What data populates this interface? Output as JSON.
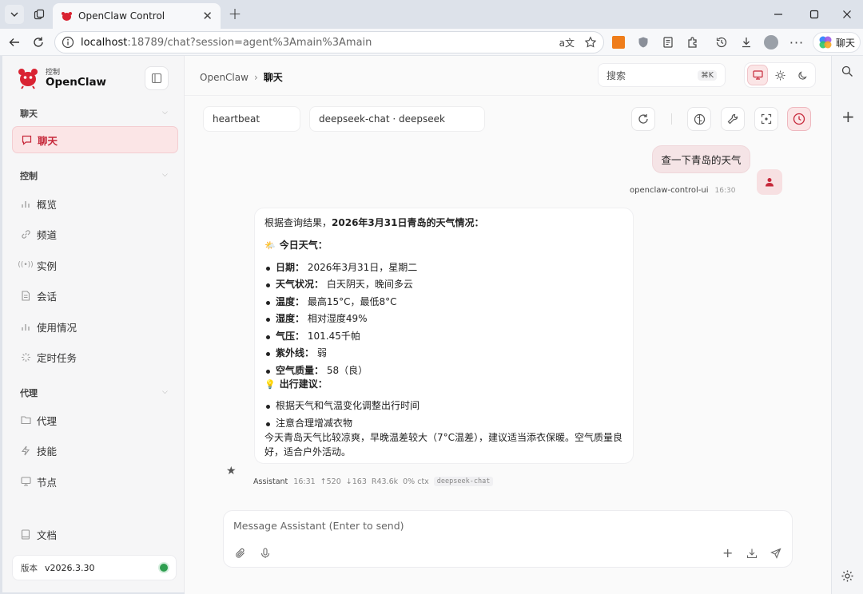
{
  "browser": {
    "tab_title": "OpenClaw Control",
    "url_host": "localhost",
    "url_rest": ":18789/chat?session=agent%3Amain%3Amain",
    "copilot_label": "聊天"
  },
  "sidebar": {
    "brand_sub": "控制",
    "brand_name": "OpenClaw",
    "sections": [
      {
        "title": "聊天",
        "items": [
          {
            "label": "聊天",
            "icon": "chat-icon",
            "active": true
          }
        ]
      },
      {
        "title": "控制",
        "items": [
          {
            "label": "概览",
            "icon": "bar-chart-icon"
          },
          {
            "label": "频道",
            "icon": "link-icon"
          },
          {
            "label": "实例",
            "icon": "radio-icon"
          },
          {
            "label": "会话",
            "icon": "document-icon"
          },
          {
            "label": "使用情况",
            "icon": "bar-chart-icon"
          },
          {
            "label": "定时任务",
            "icon": "loader-icon"
          }
        ]
      },
      {
        "title": "代理",
        "items": [
          {
            "label": "代理",
            "icon": "folder-icon"
          },
          {
            "label": "技能",
            "icon": "bolt-icon"
          },
          {
            "label": "节点",
            "icon": "monitor-icon"
          }
        ]
      }
    ],
    "docs_label": "文档",
    "version_label": "版本",
    "version_value": "v2026.3.30",
    "status_color": "#2e9e4f"
  },
  "header": {
    "breadcrumb_parent": "OpenClaw",
    "breadcrumb_sep": "›",
    "breadcrumb_current": "聊天",
    "search_placeholder": "搜索",
    "search_shortcut": "⌘K"
  },
  "chat": {
    "session_chip": "heartbeat",
    "model_chip": "deepseek-chat · deepseek",
    "user_message": "查一下青岛的天气",
    "user_sender": "openclaw-control-ui",
    "user_time": "16:30",
    "assistant": {
      "intro_plain": "根据查询结果，",
      "intro_bold": "2026年3月31日青岛的天气情况：",
      "today_emoji": "🌤️",
      "today_heading": "今日天气：",
      "details": [
        {
          "label": "日期：",
          "value": "2026年3月31日，星期二"
        },
        {
          "label": "天气状况：",
          "value": "白天阴天，晚间多云"
        },
        {
          "label": "温度：",
          "value": "最高15°C，最低8°C"
        },
        {
          "label": "湿度：",
          "value": "相对湿度49%"
        },
        {
          "label": "气压：",
          "value": "101.45千帕"
        },
        {
          "label": "紫外线：",
          "value": "弱"
        },
        {
          "label": "空气质量：",
          "value": "58（良）"
        }
      ],
      "tips_emoji": "💡",
      "tips_heading": "出行建议：",
      "tips": [
        "根据天气和气温变化调整出行时间",
        "注意合理增减衣物"
      ],
      "summary": "今天青岛天气比较凉爽，早晚温差较大（7°C温差），建议适当添衣保暖。空气质量良好，适合户外活动。",
      "meta": {
        "name": "Assistant",
        "time": "16:31",
        "tokens_in": "↑520",
        "tokens_out": "↓163",
        "cache": "R43.6k",
        "ctx": "0% ctx",
        "model": "deepseek-chat"
      }
    },
    "composer_placeholder": "Message Assistant (Enter to send)"
  },
  "colors": {
    "accent": "#c6283a",
    "accent_bg": "#fbe5e6"
  }
}
